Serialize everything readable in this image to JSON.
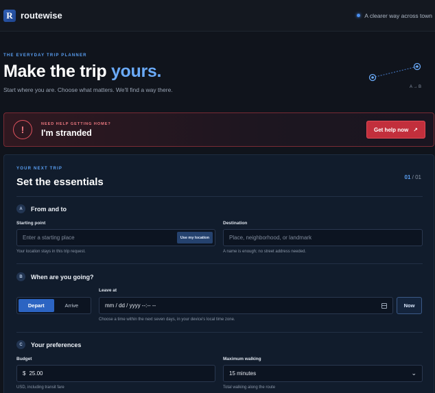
{
  "topbar": {
    "logo_letter": "R",
    "brand": "routewise",
    "tagline": "A clearer way across town"
  },
  "hero": {
    "eyebrow": "THE EVERYDAY TRIP PLANNER",
    "title_main": "Make the trip ",
    "title_accent": "yours.",
    "subtitle": "Start where you are. Choose what matters. We'll find a way there.",
    "route_label": "A → B"
  },
  "stranded": {
    "icon_glyph": "!",
    "eyebrow": "NEED HELP GETTING HOME?",
    "title": "I'm stranded",
    "button_label": "Get help now",
    "button_arrow": "↗"
  },
  "form": {
    "eyebrow": "YOUR NEXT TRIP",
    "title": "Set the essentials",
    "step_current": "01",
    "step_total": " / 01",
    "sections": {
      "a": {
        "badge": "A",
        "title": "From and to"
      },
      "b": {
        "badge": "B",
        "title": "When are you going?"
      },
      "c": {
        "badge": "C",
        "title": "Your preferences"
      }
    },
    "start": {
      "label": "Starting point",
      "placeholder": "Enter a starting place",
      "locate_label": "Use my location",
      "hint": "Your location stays in this trip request."
    },
    "destination": {
      "label": "Destination",
      "placeholder": "Place, neighborhood, or landmark",
      "hint": "A name is enough; no street address needed."
    },
    "timing": {
      "depart_label": "Depart",
      "arrive_label": "Arrive",
      "selected": "Depart",
      "leave_label": "Leave at",
      "datetime_placeholder": "mm / dd / yyyy  --:-- --",
      "now_label": "Now",
      "hint": "Choose a time within the next seven days, in your device's local time zone."
    },
    "budget": {
      "label": "Budget",
      "currency": "$",
      "value": "25.00",
      "hint": "USD, including transit fare"
    },
    "walking": {
      "label": "Maximum walking",
      "value": "15 minutes",
      "hint": "Total walking along the route"
    }
  },
  "colors": {
    "accent": "#5aa0f5",
    "danger": "#c22f3c",
    "primary_button": "#2c64c2"
  }
}
